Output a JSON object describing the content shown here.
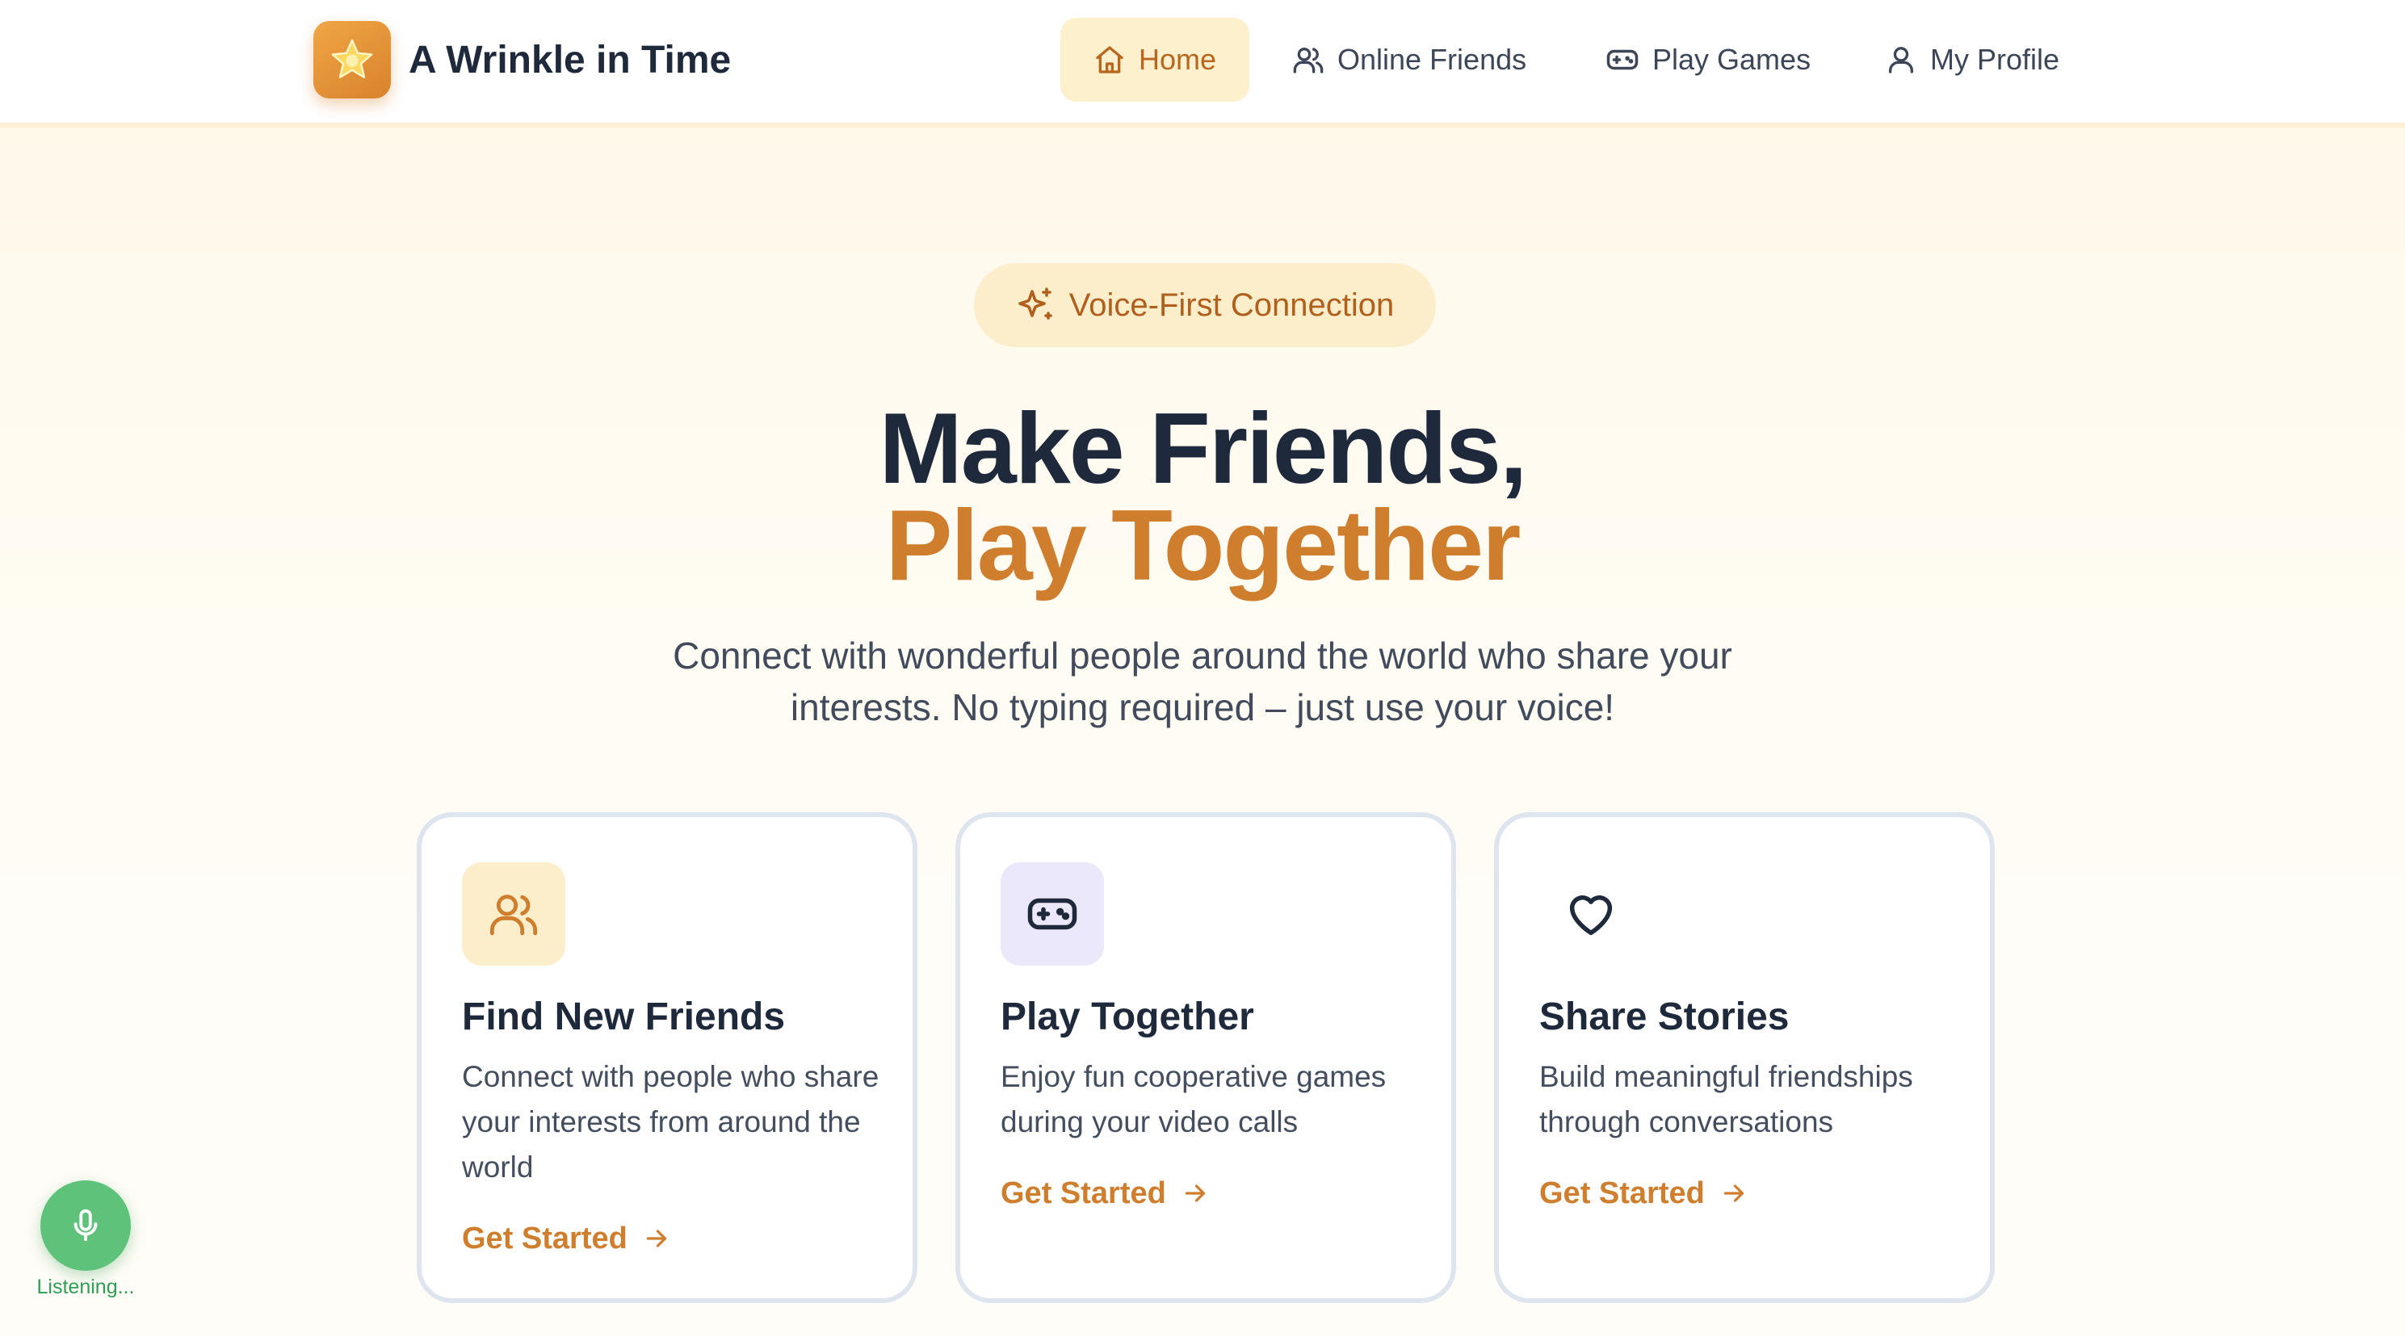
{
  "app": {
    "title": "A Wrinkle in Time",
    "logo_icon": "star-icon"
  },
  "nav": {
    "items": [
      {
        "label": "Home",
        "icon": "home-icon",
        "active": true
      },
      {
        "label": "Online Friends",
        "icon": "users-icon",
        "active": false
      },
      {
        "label": "Play Games",
        "icon": "gamepad-icon",
        "active": false
      },
      {
        "label": "My Profile",
        "icon": "user-icon",
        "active": false
      }
    ]
  },
  "hero": {
    "badge": "Voice-First Connection",
    "badge_icon": "sparkles-icon",
    "headline_line1": "Make Friends,",
    "headline_line2": "Play Together",
    "subtitle": "Connect with wonderful people around the world who share your interests. No typing required – just use your voice!"
  },
  "features": [
    {
      "title": "Find New Friends",
      "description": "Connect with people who share your interests from around the world",
      "cta": "Get Started",
      "icon": "users-icon"
    },
    {
      "title": "Play Together",
      "description": "Enjoy fun cooperative games during your video calls",
      "cta": "Get Started",
      "icon": "gamepad-icon"
    },
    {
      "title": "Share Stories",
      "description": "Build meaningful friendships through conversations",
      "cta": "Get Started",
      "icon": "heart-icon"
    }
  ],
  "voice": {
    "status": "Listening...",
    "icon": "microphone-icon"
  },
  "colors": {
    "accent": "#cf7e2e",
    "nav_active_bg": "#fdf0cc",
    "listening": "#5fc27a"
  }
}
